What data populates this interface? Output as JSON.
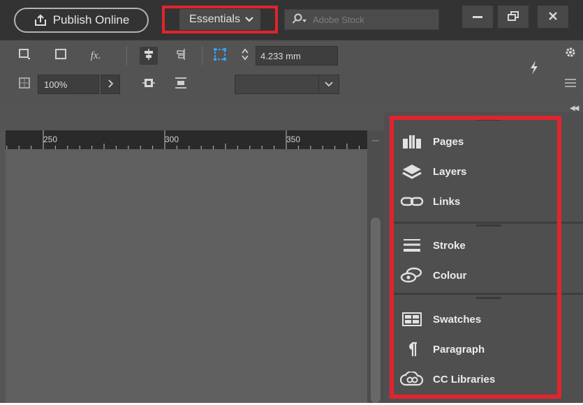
{
  "header": {
    "publish_label": "Publish Online",
    "workspace_label": "Essentials",
    "search_placeholder": "Adobe Stock"
  },
  "controls": {
    "opacity_value": "100%",
    "stroke_weight_value": "4.233 mm",
    "fx_label": "fx."
  },
  "ruler": {
    "ticks": [
      "250",
      "300",
      "350"
    ]
  },
  "panels": [
    {
      "label": "Pages",
      "icon": "pages-icon"
    },
    {
      "label": "Layers",
      "icon": "layers-icon"
    },
    {
      "label": "Links",
      "icon": "links-icon"
    },
    {
      "label": "Stroke",
      "icon": "stroke-icon"
    },
    {
      "label": "Colour",
      "icon": "colour-icon"
    },
    {
      "label": "Swatches",
      "icon": "swatches-icon"
    },
    {
      "label": "Paragraph",
      "icon": "paragraph-icon"
    },
    {
      "label": "CC Libraries",
      "icon": "cc-libraries-icon"
    }
  ],
  "colors": {
    "highlight": "#e0242e",
    "app_background": "#5c5c5c",
    "appbar_background": "#333333"
  }
}
